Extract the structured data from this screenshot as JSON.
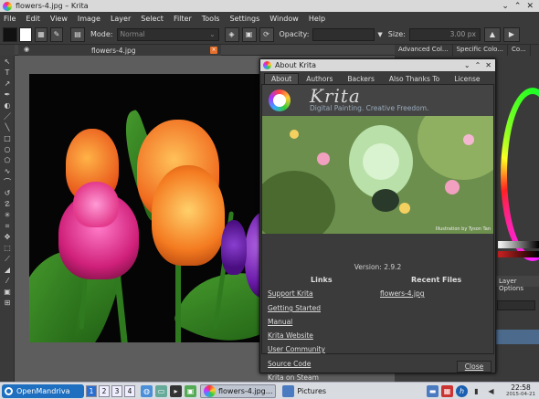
{
  "window": {
    "title": "flowers-4.jpg – Krita"
  },
  "menu": [
    "File",
    "Edit",
    "View",
    "Image",
    "Layer",
    "Select",
    "Filter",
    "Tools",
    "Settings",
    "Window",
    "Help"
  ],
  "toolbar": {
    "mode_label": "Mode:",
    "mode_value": "Normal",
    "opacity_label": "Opacity:",
    "opacity_value": "",
    "size_label": "Size:",
    "size_value": "3.00 px"
  },
  "dock_tabs": [
    "Advanced Col...",
    "Specific Colo...",
    "Co..."
  ],
  "document_tab": {
    "name": "flowers-4.jpg"
  },
  "right_dock": {
    "layer_options": "Layer Options"
  },
  "about_dialog": {
    "title": "About Krita",
    "tabs": [
      "About",
      "Authors",
      "Backers",
      "Also Thanks To",
      "License"
    ],
    "brand": "Krita",
    "tagline": "Digital Painting. Creative Freedom.",
    "splash_credit": "Illustration by Tyson Tan",
    "version": "Version: 2.9.2",
    "links_heading": "Links",
    "recent_heading": "Recent Files",
    "links": [
      "Support Krita",
      "Getting Started",
      "Manual",
      "Krita Website",
      "User Community",
      "Source Code"
    ],
    "plain_item": "Krita on Steam",
    "recent_files": [
      "flowers-4.jpg"
    ],
    "close_label": "Close"
  },
  "taskbar": {
    "start_label": "OpenMandriva",
    "desktops": [
      "1",
      "2",
      "3",
      "4"
    ],
    "tasks": [
      {
        "label": "flowers-4.jpg...",
        "active": true
      },
      {
        "label": "Pictures",
        "active": false
      }
    ],
    "clock_time": "22:58",
    "clock_date": "2015-04-21"
  }
}
